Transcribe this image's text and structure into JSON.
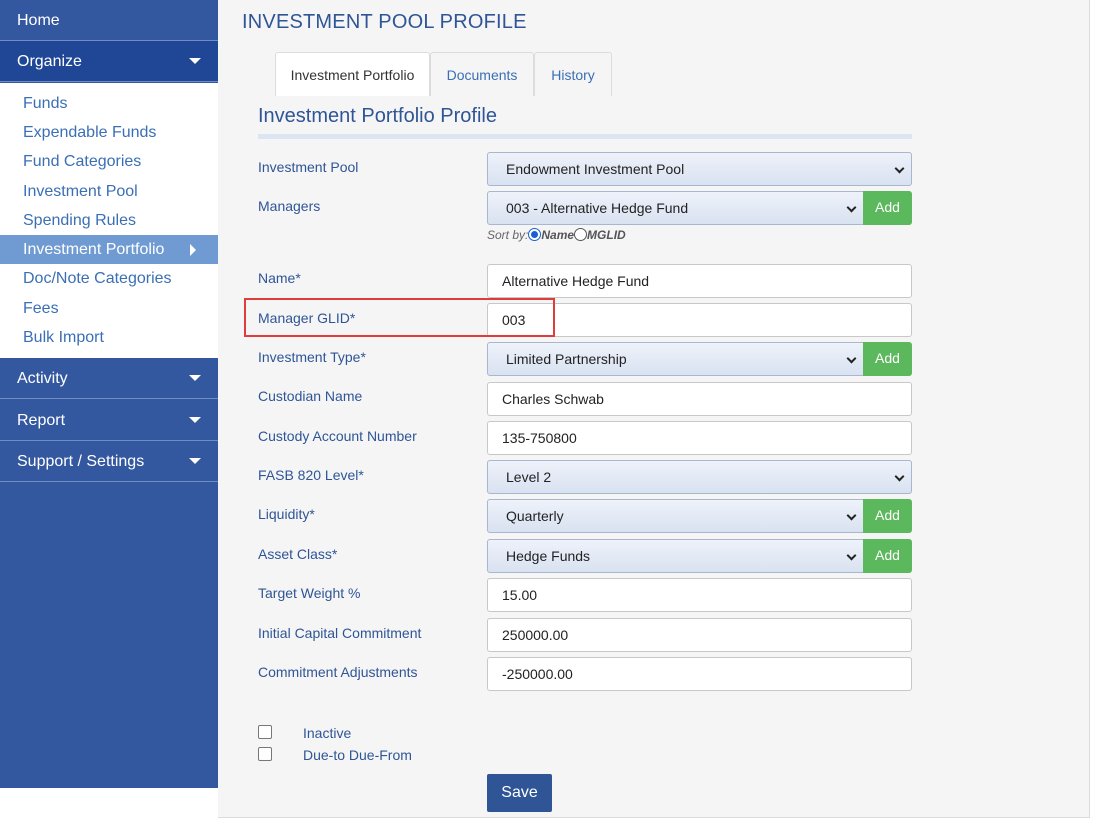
{
  "sidebar": {
    "home": "Home",
    "organize": "Organize",
    "items": [
      "Funds",
      "Expendable Funds",
      "Fund Categories",
      "Investment Pool",
      "Spending Rules",
      "Investment Portfolio",
      "Doc/Note Categories",
      "Fees",
      "Bulk Import"
    ],
    "activity": "Activity",
    "report": "Report",
    "support": "Support / Settings"
  },
  "main": {
    "title": "INVESTMENT POOL PROFILE",
    "tabs": [
      "Investment Portfolio",
      "Documents",
      "History"
    ],
    "section_title": "Investment Portfolio Profile"
  },
  "form": {
    "investment_pool": {
      "label": "Investment Pool",
      "value": "Endowment Investment Pool"
    },
    "managers": {
      "label": "Managers",
      "value": "003 - Alternative Hedge Fund"
    },
    "sort": {
      "prefix": "Sort by:",
      "option1": "Name",
      "option2": "MGLID"
    },
    "name": {
      "label": "Name*",
      "value": "Alternative Hedge Fund"
    },
    "manager_glid": {
      "label": "Manager GLID*",
      "value": "003"
    },
    "investment_type": {
      "label": "Investment Type*",
      "value": "Limited Partnership"
    },
    "custodian_name": {
      "label": "Custodian Name",
      "value": "Charles Schwab"
    },
    "custody_account": {
      "label": "Custody Account Number",
      "value": "135-750800"
    },
    "fasb_level": {
      "label": "FASB 820 Level*",
      "value": "Level 2"
    },
    "liquidity": {
      "label": "Liquidity*",
      "value": "Quarterly"
    },
    "asset_class": {
      "label": "Asset Class*",
      "value": "Hedge Funds"
    },
    "target_weight": {
      "label": "Target Weight %",
      "value": "15.00"
    },
    "initial_commitment": {
      "label": "Initial Capital Commitment",
      "value": "250000.00"
    },
    "commitment_adjustments": {
      "label": "Commitment Adjustments",
      "value": "-250000.00"
    },
    "inactive": "Inactive",
    "due_to": "Due-to Due-From",
    "add_label": "Add",
    "save_label": "Save"
  }
}
